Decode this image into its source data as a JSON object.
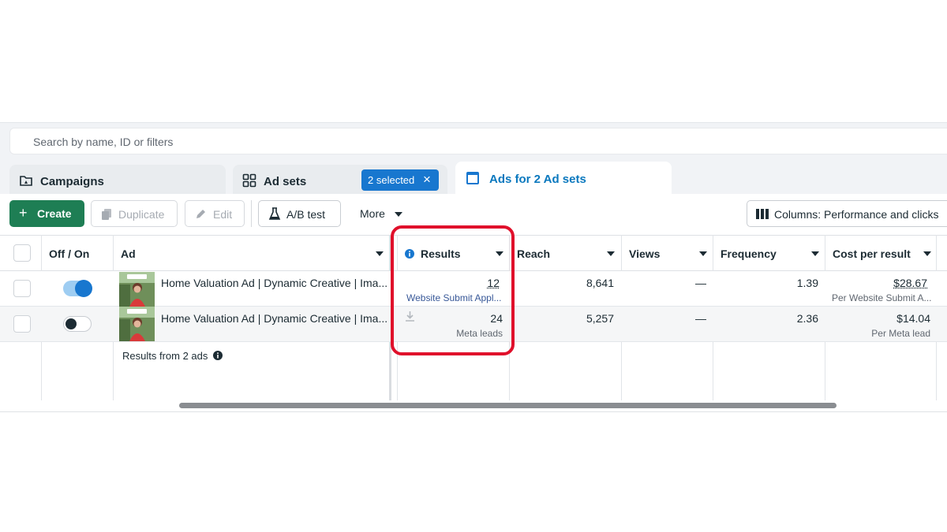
{
  "search": {
    "placeholder": "Search by name, ID or filters"
  },
  "tabs": {
    "campaigns": "Campaigns",
    "adsets": "Ad sets",
    "selected_badge": "2 selected",
    "ads": "Ads for 2 Ad sets"
  },
  "toolbar": {
    "create": "Create",
    "duplicate": "Duplicate",
    "edit": "Edit",
    "ab_test": "A/B test",
    "more": "More",
    "columns": "Columns: Performance and clicks"
  },
  "columns": [
    "Off / On",
    "Ad",
    "Results",
    "Reach",
    "Views",
    "Frequency",
    "Cost per result"
  ],
  "rows": [
    {
      "toggle": "on",
      "ad": "Home Valuation Ad | Dynamic Creative | Ima...",
      "results": "12",
      "results_sub": "Website Submit Appl...",
      "reach": "8,641",
      "views": "—",
      "frequency": "1.39",
      "cost": "$28.67",
      "cost_sub": "Per Website Submit A..."
    },
    {
      "toggle": "off",
      "ad": "Home Valuation Ad | Dynamic Creative | Ima...",
      "results": "24",
      "results_sub": "Meta leads",
      "reach": "5,257",
      "views": "—",
      "frequency": "2.36",
      "cost": "$14.04",
      "cost_sub": "Per Meta lead"
    }
  ],
  "summary": "Results from 2 ads",
  "colors": {
    "accent": "#1877cf",
    "create": "#1e7e54",
    "highlight": "#e0102b"
  }
}
